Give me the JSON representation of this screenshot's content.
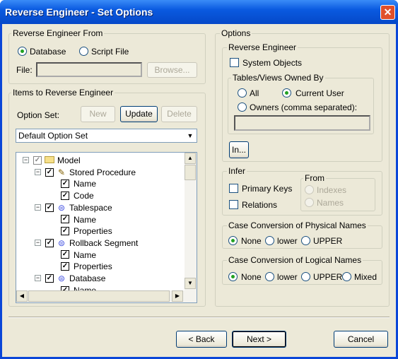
{
  "window": {
    "title": "Reverse Engineer  - Set Options",
    "close_icon": "close-icon"
  },
  "from": {
    "legend": "Reverse Engineer From",
    "database": "Database",
    "script_file": "Script File",
    "selected": "Database",
    "file_label": "File:",
    "file_value": "",
    "browse": "Browse..."
  },
  "items": {
    "legend": "Items to Reverse Engineer",
    "option_set_label": "Option Set:",
    "new": "New",
    "update": "Update",
    "delete": "Delete",
    "option_set_value": "Default Option Set",
    "tree": [
      {
        "label": "Model",
        "level": 0,
        "icon": "folder-icon",
        "checked": true
      },
      {
        "label": "Stored Procedure",
        "level": 1,
        "icon": "procedure-icon",
        "checked": true
      },
      {
        "label": "Name",
        "level": 2,
        "checked": true
      },
      {
        "label": "Code",
        "level": 2,
        "checked": true
      },
      {
        "label": "Tablespace",
        "level": 1,
        "icon": "database-icon",
        "checked": true
      },
      {
        "label": "Name",
        "level": 2,
        "checked": true
      },
      {
        "label": "Properties",
        "level": 2,
        "checked": true
      },
      {
        "label": "Rollback Segment",
        "level": 1,
        "icon": "database-icon",
        "checked": true
      },
      {
        "label": "Name",
        "level": 2,
        "checked": true
      },
      {
        "label": "Properties",
        "level": 2,
        "checked": true
      },
      {
        "label": "Database",
        "level": 1,
        "icon": "database-icon",
        "checked": true
      },
      {
        "label": "Name",
        "level": 2,
        "checked": true
      }
    ]
  },
  "options": {
    "legend": "Options",
    "re": {
      "legend": "Reverse Engineer",
      "system_objects": "System Objects",
      "owned_legend": "Tables/Views Owned By",
      "all": "All",
      "current_user": "Current User",
      "owners": "Owners (comma separated):",
      "owners_value": "",
      "in": "In..."
    },
    "infer": {
      "legend": "Infer",
      "primary_keys": "Primary Keys",
      "relations": "Relations",
      "from_legend": "From",
      "indexes": "Indexes",
      "names": "Names"
    },
    "physical": {
      "legend": "Case Conversion of Physical Names",
      "none": "None",
      "lower": "lower",
      "upper": "UPPER",
      "selected": "None"
    },
    "logical": {
      "legend": "Case Conversion of Logical Names",
      "none": "None",
      "lower": "lower",
      "upper": "UPPER",
      "mixed": "Mixed",
      "selected": "None"
    }
  },
  "footer": {
    "back": "< Back",
    "next": "Next >",
    "cancel": "Cancel"
  }
}
